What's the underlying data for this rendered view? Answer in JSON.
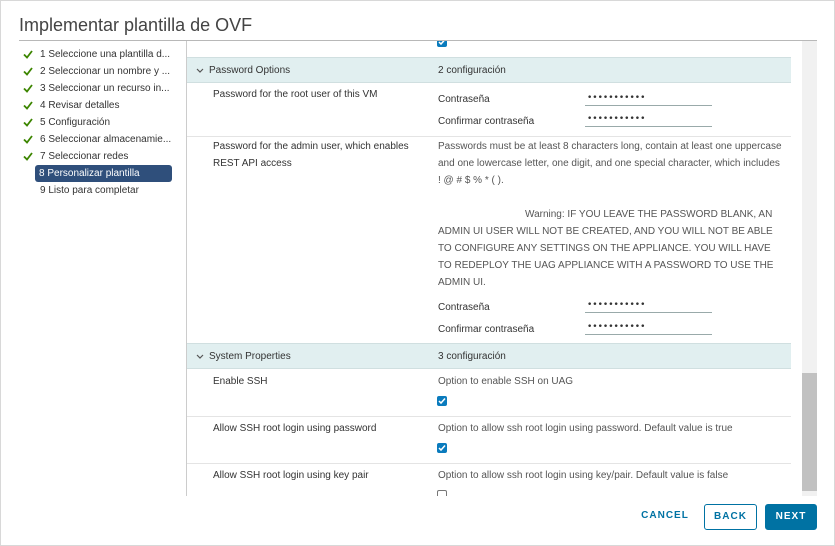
{
  "dialog": {
    "title": "Implementar plantilla de OVF"
  },
  "steps": [
    {
      "label": "1 Seleccione una plantilla d...",
      "done": true
    },
    {
      "label": "2 Seleccionar un nombre y ...",
      "done": true
    },
    {
      "label": "3 Seleccionar un recurso in...",
      "done": true
    },
    {
      "label": "4 Revisar detalles",
      "done": true
    },
    {
      "label": "5 Configuración",
      "done": true
    },
    {
      "label": "6 Seleccionar almacenamie...",
      "done": true
    },
    {
      "label": "7 Seleccionar redes",
      "done": true
    },
    {
      "label": "8 Personalizar plantilla",
      "done": true,
      "active": true
    },
    {
      "label": "9 Listo para completar",
      "done": false
    }
  ],
  "password_options": {
    "name": "Password Options",
    "count": "2 configuración",
    "root": {
      "label": "Password for the root user of this VM",
      "password_label": "Contraseña",
      "password_value": "•••••••••••",
      "confirm_label": "Confirmar contraseña",
      "confirm_value": "•••••••••••"
    },
    "admin": {
      "label": "Password for the admin user, which enables REST API access",
      "rules": "Passwords must be at least 8 characters long, contain at least one uppercase and one lowercase letter, one digit, and one special character, which includes ! @ # $ % * ( ).",
      "warning": "Warning: IF YOU LEAVE THE PASSWORD BLANK, AN ADMIN UI USER WILL NOT BE CREATED, AND YOU WILL NOT BE ABLE TO CONFIGURE ANY SETTINGS ON THE APPLIANCE. YOU WILL HAVE TO REDEPLOY THE UAG APPLIANCE WITH A PASSWORD TO USE THE ADMIN UI.",
      "password_label": "Contraseña",
      "password_value": "•••••••••••",
      "confirm_label": "Confirmar contraseña",
      "confirm_value": "•••••••••••"
    }
  },
  "system_properties": {
    "name": "System Properties",
    "count": "3 configuración",
    "ssh": {
      "label": "Enable SSH",
      "desc": "Option to enable SSH on UAG",
      "checked": true
    },
    "ssh_pwd": {
      "label": "Allow SSH root login using password",
      "desc": "Option to allow ssh root login using password. Default value is true",
      "checked": true
    },
    "ssh_key": {
      "label": "Allow SSH root login using key pair",
      "desc": "Option to allow ssh root login using key/pair. Default value is false",
      "checked": false
    }
  },
  "footer": {
    "cancel": "CANCEL",
    "back": "BACK",
    "next": "NEXT"
  },
  "colors": {
    "accent": "#0072a3",
    "active_step": "#2f4f7b",
    "section_bg": "#e1eff0",
    "check_green": "#3c8500"
  }
}
